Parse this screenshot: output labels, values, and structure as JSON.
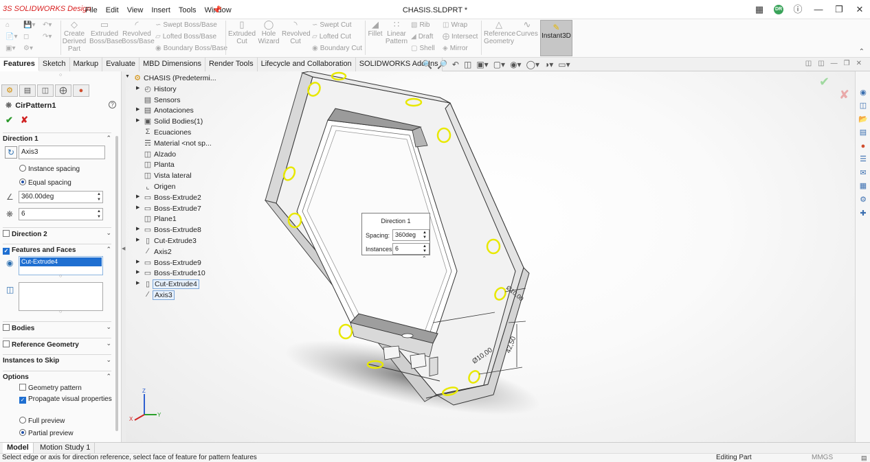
{
  "app": {
    "brand": "SOLIDWORKS",
    "brand_suffix": "Design",
    "document_title": "CHASIS.SLDPRT *"
  },
  "menu": [
    "File",
    "Edit",
    "View",
    "Insert",
    "Tools",
    "Window"
  ],
  "user_initials": "DR",
  "ribbon": {
    "create_derived": "Create Derived Part",
    "extruded_boss": "Extruded Boss/Base",
    "revolved_boss": "Revolved Boss/Base",
    "swept_boss": "Swept Boss/Base",
    "lofted_boss": "Lofted Boss/Base",
    "boundary_boss": "Boundary Boss/Base",
    "extruded_cut": "Extruded Cut",
    "hole_wizard": "Hole Wizard",
    "revolved_cut": "Revolved Cut",
    "swept_cut": "Swept Cut",
    "lofted_cut": "Lofted Cut",
    "boundary_cut": "Boundary Cut",
    "fillet": "Fillet",
    "linear_pattern": "Linear Pattern",
    "rib": "Rib",
    "draft": "Draft",
    "shell": "Shell",
    "wrap": "Wrap",
    "intersect": "Intersect",
    "mirror": "Mirror",
    "reference_geometry": "Reference Geometry",
    "curves": "Curves",
    "instant3d": "Instant3D"
  },
  "tabs": [
    "Features",
    "Sketch",
    "Markup",
    "Evaluate",
    "MBD Dimensions",
    "Render Tools",
    "Lifecycle and Collaboration",
    "SOLIDWORKS Add-Ins"
  ],
  "property_manager": {
    "title": "CirPattern1",
    "direction1": {
      "label": "Direction 1",
      "axis": "Axis3",
      "instance_spacing": "Instance spacing",
      "equal_spacing": "Equal spacing",
      "angle": "360.00deg",
      "count": "6"
    },
    "direction2": {
      "label": "Direction 2"
    },
    "features_and_faces": {
      "label": "Features and Faces",
      "selected": "Cut-Extrude4"
    },
    "bodies": "Bodies",
    "reference_geometry": "Reference Geometry",
    "instances_to_skip": "Instances to Skip",
    "options": {
      "label": "Options",
      "geometry_pattern": "Geometry pattern",
      "propagate_visual": "Propagate visual properties",
      "full_preview": "Full preview",
      "partial_preview": "Partial preview"
    }
  },
  "tree": [
    {
      "label": "CHASIS  (Predetermi...",
      "arrow": "down",
      "icon": "part-icon"
    },
    {
      "label": "History",
      "arrow": "right",
      "icon": "history-icon"
    },
    {
      "label": "Sensors",
      "arrow": "",
      "icon": "sensor-icon"
    },
    {
      "label": "Anotaciones",
      "arrow": "right",
      "icon": "annotation-icon"
    },
    {
      "label": "Solid Bodies(1)",
      "arrow": "right",
      "icon": "solid-body-icon"
    },
    {
      "label": "Ecuaciones",
      "arrow": "",
      "icon": "equation-icon"
    },
    {
      "label": "Material <not sp...",
      "arrow": "",
      "icon": "material-icon"
    },
    {
      "label": "Alzado",
      "arrow": "",
      "icon": "plane-icon"
    },
    {
      "label": "Planta",
      "arrow": "",
      "icon": "plane-icon"
    },
    {
      "label": "Vista lateral",
      "arrow": "",
      "icon": "plane-icon"
    },
    {
      "label": "Origen",
      "arrow": "",
      "icon": "origin-icon"
    },
    {
      "label": "Boss-Extrude2",
      "arrow": "right",
      "icon": "extrude-icon"
    },
    {
      "label": "Boss-Extrude7",
      "arrow": "right",
      "icon": "extrude-icon"
    },
    {
      "label": "Plane1",
      "arrow": "",
      "icon": "plane-icon"
    },
    {
      "label": "Boss-Extrude8",
      "arrow": "right",
      "icon": "extrude-icon"
    },
    {
      "label": "Cut-Extrude3",
      "arrow": "right",
      "icon": "cut-icon"
    },
    {
      "label": "Axis2",
      "arrow": "",
      "icon": "axis-icon"
    },
    {
      "label": "Boss-Extrude9",
      "arrow": "right",
      "icon": "extrude-icon"
    },
    {
      "label": "Boss-Extrude10",
      "arrow": "right",
      "icon": "extrude-icon"
    },
    {
      "label": "Cut-Extrude4",
      "arrow": "right",
      "icon": "cut-icon"
    },
    {
      "label": "Axis3",
      "arrow": "",
      "icon": "axis-icon"
    }
  ],
  "direction_popup": {
    "title": "Direction 1",
    "spacing_label": "Spacing:",
    "spacing_value": "360deg",
    "instances_label": "Instances:",
    "instances_value": "6"
  },
  "dimensions": {
    "d1": "Ø10,00",
    "d2": "Ø10,00",
    "d3": "42,50"
  },
  "triad": {
    "x": "X",
    "y": "Y",
    "z": "Z"
  },
  "bottom_tabs": [
    "Model",
    "Motion Study 1"
  ],
  "status": {
    "message": "Select edge or axis for direction reference, select face of feature for pattern features",
    "mode": "Editing Part",
    "units": "MMGS"
  },
  "colors": {
    "accent": "#1f6fd1",
    "highlight": "#e8e800",
    "ok": "#2d9a2d",
    "cancel": "#d02222"
  }
}
